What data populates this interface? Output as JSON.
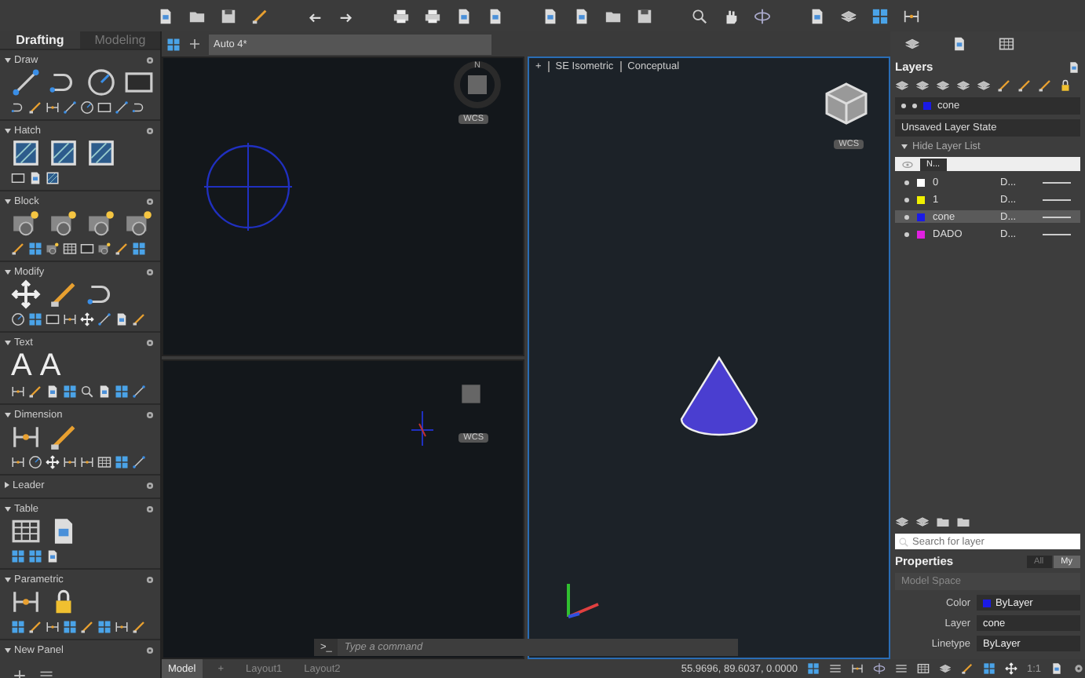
{
  "palette": {
    "tabs": [
      {
        "label": "Drafting",
        "selected": true
      },
      {
        "label": "Modeling",
        "selected": false
      }
    ],
    "sections": [
      {
        "title": "Draw",
        "expanded": true
      },
      {
        "title": "Hatch",
        "expanded": true
      },
      {
        "title": "Block",
        "expanded": true
      },
      {
        "title": "Modify",
        "expanded": true
      },
      {
        "title": "Text",
        "expanded": true,
        "glyphs": [
          "A",
          "A"
        ]
      },
      {
        "title": "Dimension",
        "expanded": true
      },
      {
        "title": "Leader",
        "expanded": false
      },
      {
        "title": "Table",
        "expanded": true
      },
      {
        "title": "Parametric",
        "expanded": true
      },
      {
        "title": "New Panel",
        "expanded": true
      }
    ]
  },
  "document_tab": {
    "label": "Auto 4*"
  },
  "viewports": [
    {
      "kind": "top",
      "active": false,
      "compass": "N",
      "ucs": "WCS"
    },
    {
      "kind": "blank",
      "active": false,
      "ucs": "WCS"
    },
    {
      "kind": "iso",
      "active": true,
      "controls": [
        "+",
        "SE Isometric",
        "Conceptual"
      ],
      "ucs": "WCS"
    }
  ],
  "command_line": {
    "prompt": ">_",
    "placeholder": "Type a command"
  },
  "layout_tabs": [
    {
      "label": "Model",
      "selected": true
    },
    {
      "label": "Layout1",
      "selected": false
    },
    {
      "label": "Layout2",
      "selected": false
    }
  ],
  "new_layout": "+",
  "coordinates": "55.9696, 89.6037, 0.0000",
  "annotation_scale": "1:1",
  "layers_panel": {
    "title": "Layers",
    "current_layer": {
      "name": "cone",
      "color": "#1a1ae6"
    },
    "layer_state": "Unsaved Layer State",
    "toggle": "Hide Layer List",
    "name_column": "N...",
    "rows": [
      {
        "name": "0",
        "color": "#ffffff",
        "linetype": "D...",
        "selected": false
      },
      {
        "name": "1",
        "color": "#f0f000",
        "linetype": "D...",
        "selected": false
      },
      {
        "name": "cone",
        "color": "#1a1ae6",
        "linetype": "D...",
        "selected": true
      },
      {
        "name": "DADO",
        "color": "#e020e0",
        "linetype": "D...",
        "selected": false
      }
    ],
    "search": {
      "placeholder": "Search for layer"
    }
  },
  "properties": {
    "title": "Properties",
    "filters": [
      {
        "label": "All",
        "selected": false
      },
      {
        "label": "My",
        "selected": true
      }
    ],
    "context": "Model Space",
    "rows": [
      {
        "label": "Color",
        "value": "ByLayer",
        "color": "#1a1ae6"
      },
      {
        "label": "Layer",
        "value": "cone"
      },
      {
        "label": "Linetype",
        "value": "ByLayer"
      }
    ]
  }
}
